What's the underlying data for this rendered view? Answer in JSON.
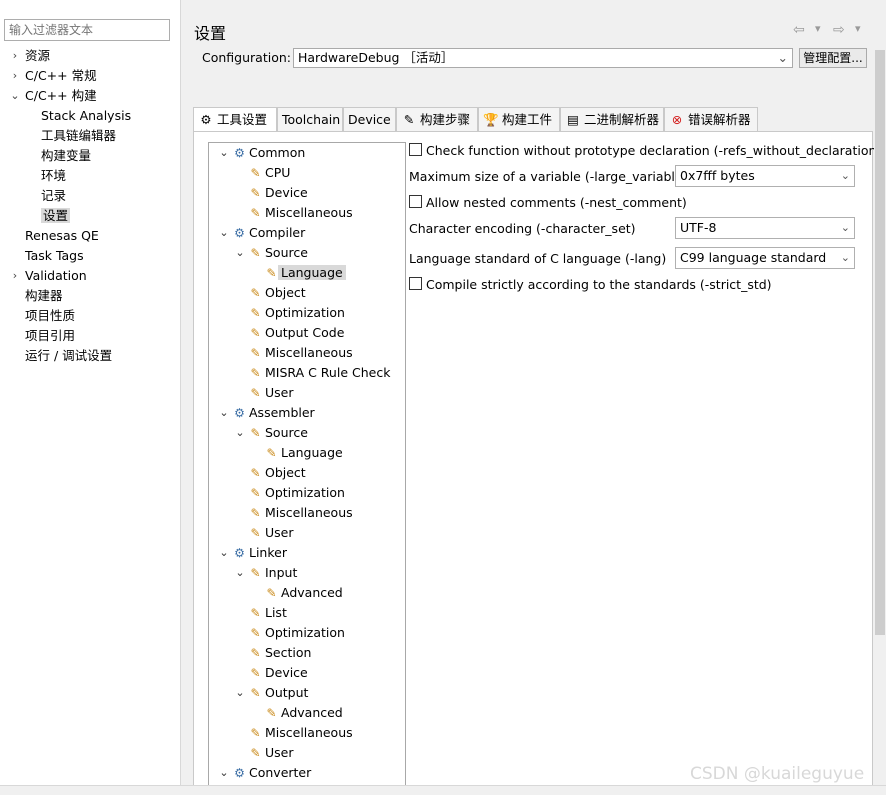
{
  "filter": {
    "placeholder": "输入过滤器文本"
  },
  "nav": {
    "items": [
      {
        "label": "资源",
        "level": 0,
        "toggle": "›"
      },
      {
        "label": "C/C++ 常规",
        "level": 0,
        "toggle": "›"
      },
      {
        "label": "C/C++ 构建",
        "level": 0,
        "toggle": "⌄"
      },
      {
        "label": "Stack Analysis",
        "level": 1
      },
      {
        "label": "工具链编辑器",
        "level": 1
      },
      {
        "label": "构建变量",
        "level": 1
      },
      {
        "label": "环境",
        "level": 1
      },
      {
        "label": "记录",
        "level": 1
      },
      {
        "label": "设置",
        "level": 1,
        "selected": true
      },
      {
        "label": "Renesas QE",
        "level": 0
      },
      {
        "label": "Task Tags",
        "level": 0
      },
      {
        "label": "Validation",
        "level": 0,
        "toggle": "›"
      },
      {
        "label": "构建器",
        "level": 0
      },
      {
        "label": "项目性质",
        "level": 0
      },
      {
        "label": "项目引用",
        "level": 0
      },
      {
        "label": "运行 / 调试设置",
        "level": 0
      }
    ]
  },
  "header": {
    "title": "设置",
    "back_icon": "⇦",
    "forward_icon": "⇨",
    "dropdown_icon": "▾",
    "menu_icon": "▾"
  },
  "config": {
    "label": "Configuration:",
    "value": "HardwareDebug ［活动］",
    "manage_label": "管理配置..."
  },
  "tabs": [
    {
      "label": "工具设置",
      "icon": "⚙",
      "active": true
    },
    {
      "label": "Toolchain",
      "icon": ""
    },
    {
      "label": "Device",
      "icon": ""
    },
    {
      "label": "构建步骤",
      "icon": "✎"
    },
    {
      "label": "构建工件",
      "icon": "🏆"
    },
    {
      "label": "二进制解析器",
      "icon": "▤"
    },
    {
      "label": "错误解析器",
      "icon": "⊗"
    }
  ],
  "tree": [
    {
      "label": "Common",
      "depth": 0,
      "toggle": "⌄",
      "icon": "gear"
    },
    {
      "label": "CPU",
      "depth": 1,
      "icon": "tool"
    },
    {
      "label": "Device",
      "depth": 1,
      "icon": "tool"
    },
    {
      "label": "Miscellaneous",
      "depth": 1,
      "icon": "tool"
    },
    {
      "label": "Compiler",
      "depth": 0,
      "toggle": "⌄",
      "icon": "gear"
    },
    {
      "label": "Source",
      "depth": 1,
      "toggle": "⌄",
      "icon": "tool"
    },
    {
      "label": "Language",
      "depth": 2,
      "icon": "tool",
      "selected": true
    },
    {
      "label": "Object",
      "depth": 1,
      "icon": "tool"
    },
    {
      "label": "Optimization",
      "depth": 1,
      "icon": "tool"
    },
    {
      "label": "Output Code",
      "depth": 1,
      "icon": "tool"
    },
    {
      "label": "Miscellaneous",
      "depth": 1,
      "icon": "tool"
    },
    {
      "label": "MISRA C Rule Check",
      "depth": 1,
      "icon": "tool"
    },
    {
      "label": "User",
      "depth": 1,
      "icon": "tool"
    },
    {
      "label": "Assembler",
      "depth": 0,
      "toggle": "⌄",
      "icon": "gear"
    },
    {
      "label": "Source",
      "depth": 1,
      "toggle": "⌄",
      "icon": "tool"
    },
    {
      "label": "Language",
      "depth": 2,
      "icon": "tool"
    },
    {
      "label": "Object",
      "depth": 1,
      "icon": "tool"
    },
    {
      "label": "Optimization",
      "depth": 1,
      "icon": "tool"
    },
    {
      "label": "Miscellaneous",
      "depth": 1,
      "icon": "tool"
    },
    {
      "label": "User",
      "depth": 1,
      "icon": "tool"
    },
    {
      "label": "Linker",
      "depth": 0,
      "toggle": "⌄",
      "icon": "gear"
    },
    {
      "label": "Input",
      "depth": 1,
      "toggle": "⌄",
      "icon": "tool"
    },
    {
      "label": "Advanced",
      "depth": 2,
      "icon": "tool"
    },
    {
      "label": "List",
      "depth": 1,
      "icon": "tool"
    },
    {
      "label": "Optimization",
      "depth": 1,
      "icon": "tool"
    },
    {
      "label": "Section",
      "depth": 1,
      "icon": "tool"
    },
    {
      "label": "Device",
      "depth": 1,
      "icon": "tool"
    },
    {
      "label": "Output",
      "depth": 1,
      "toggle": "⌄",
      "icon": "tool"
    },
    {
      "label": "Advanced",
      "depth": 2,
      "icon": "tool"
    },
    {
      "label": "Miscellaneous",
      "depth": 1,
      "icon": "tool"
    },
    {
      "label": "User",
      "depth": 1,
      "icon": "tool"
    },
    {
      "label": "Converter",
      "depth": 0,
      "toggle": "⌄",
      "icon": "gear"
    }
  ],
  "options": {
    "refs_without_declaration": {
      "label": "Check function without prototype declaration (-refs_without_declaration)",
      "checked": false
    },
    "large_variable": {
      "label": "Maximum size of a variable (-large_variable)",
      "value": "0x7fff bytes"
    },
    "nest_comment": {
      "label": "Allow nested comments (-nest_comment)",
      "checked": false
    },
    "character_set": {
      "label": "Character encoding (-character_set)",
      "value": "UTF-8"
    },
    "lang": {
      "label": "Language standard of C language (-lang)",
      "value": "C99 language standard"
    },
    "strict_std": {
      "label": "Compile strictly according to the standards (-strict_std)",
      "checked": false
    }
  },
  "watermark": "CSDN @kuaileguyue"
}
